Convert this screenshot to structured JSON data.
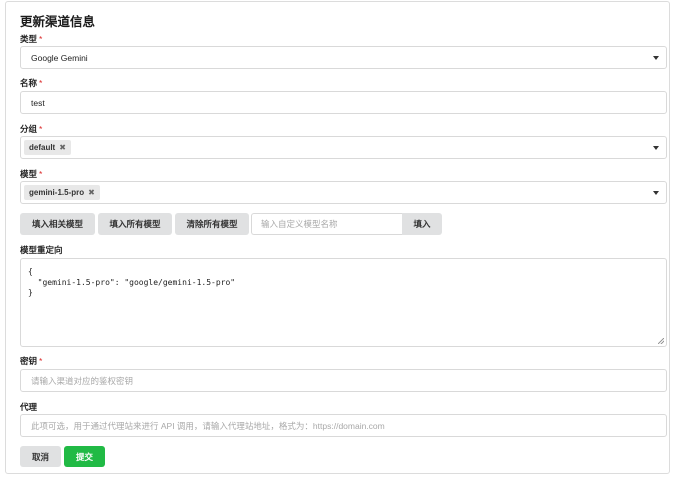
{
  "form": {
    "title": "更新渠道信息",
    "required_mark": "*",
    "type": {
      "label": "类型",
      "value": "Google Gemini"
    },
    "name": {
      "label": "名称",
      "value": "test"
    },
    "group": {
      "label": "分组",
      "chips": [
        "default"
      ]
    },
    "models": {
      "label": "模型",
      "chips": [
        "gemini-1.5-pro"
      ]
    },
    "model_buttons": {
      "fill_related": "填入相关模型",
      "fill_all": "填入所有模型",
      "clear_all": "清除所有模型",
      "custom_placeholder": "输入自定义模型名称",
      "fill": "填入"
    },
    "redirect": {
      "label": "模型重定向",
      "value": "{\n  \"gemini-1.5-pro\": \"google/gemini-1.5-pro\"\n}"
    },
    "key": {
      "label": "密钥",
      "placeholder": "请输入渠道对应的鉴权密钥"
    },
    "proxy": {
      "label": "代理",
      "placeholder": "此项可选，用于通过代理站来进行 API 调用，请输入代理站地址，格式为：https://domain.com"
    },
    "cancel": "取消",
    "submit": "提交"
  },
  "icons": {
    "dropdown": "caret-down-icon",
    "remove": "close-icon"
  },
  "colors": {
    "submit": "#21ba45",
    "required": "#db2828",
    "button_bg": "#e0e1e2"
  }
}
